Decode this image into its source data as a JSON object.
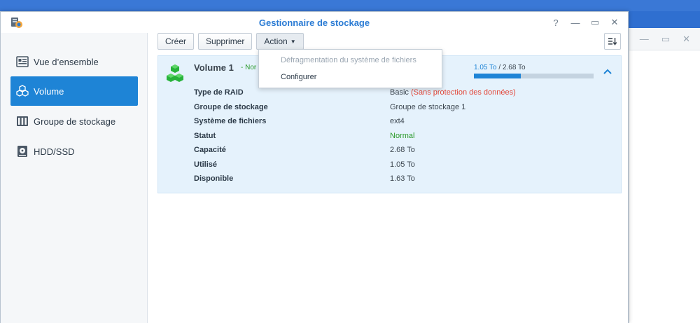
{
  "window": {
    "title": "Gestionnaire de stockage",
    "controls": {
      "help": "?",
      "minimize": "—",
      "maximize": "▭",
      "close": "✕"
    }
  },
  "bg_window": {
    "minimize": "—",
    "maximize": "▭",
    "close": "✕"
  },
  "sidebar": {
    "items": [
      {
        "label": "Vue d’ensemble",
        "icon": "overview-icon",
        "active": false
      },
      {
        "label": "Volume",
        "icon": "volume-icon",
        "active": true
      },
      {
        "label": "Groupe de stockage",
        "icon": "storage-pool-icon",
        "active": false
      },
      {
        "label": "HDD/SSD",
        "icon": "hdd-icon",
        "active": false
      }
    ]
  },
  "toolbar": {
    "create_label": "Créer",
    "delete_label": "Supprimer",
    "action_label": "Action",
    "sort_icon": "sort-icon"
  },
  "action_menu": {
    "items": [
      {
        "label": "Défragmentation du système de fichiers",
        "enabled": false
      },
      {
        "label": "Configurer",
        "enabled": true
      }
    ]
  },
  "volume": {
    "name": "Volume 1",
    "status_prefix": "- Nor",
    "used_text": "1.05 To",
    "total_text": " / 2.68 To",
    "used_fraction": 0.392,
    "details": [
      {
        "label": "Type de RAID",
        "value": "Basic ",
        "note": "(Sans protection des données)"
      },
      {
        "label": "Groupe de stockage",
        "value": "Groupe de stockage 1"
      },
      {
        "label": "Système de fichiers",
        "value": "ext4"
      },
      {
        "label": "Statut",
        "value": "Normal"
      },
      {
        "label": "Capacité",
        "value": "2.68 To"
      },
      {
        "label": "Utilisé",
        "value": "1.05 To"
      },
      {
        "label": "Disponible",
        "value": "1.63 To"
      }
    ]
  },
  "colors": {
    "accent": "#1e84d6",
    "title": "#2a7bd4",
    "ok": "#2a9a2a",
    "warn": "#e2483b",
    "panel_bg": "#e5f2fc"
  }
}
